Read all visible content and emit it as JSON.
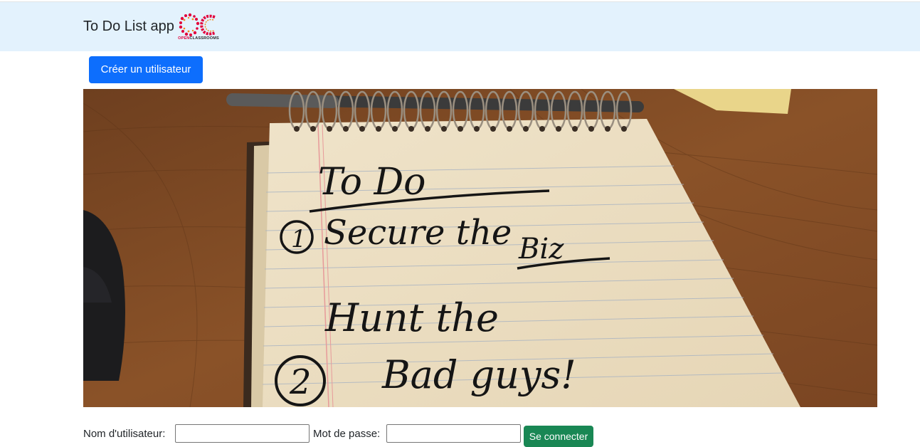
{
  "navbar": {
    "brand": "To Do List app",
    "logo_text_a": "OPEN",
    "logo_text_b": "CLASSROOMS",
    "logo_letters": "OC",
    "colors": {
      "background": "#e3f2fd",
      "logo_red": "#e2003b"
    }
  },
  "actions": {
    "create_user_label": "Créer un utilisateur",
    "accent_color": "#0d6efd"
  },
  "hero": {
    "title_line": "To Do",
    "item_1": "Secure the",
    "item_1b": "Biz",
    "item_2": "Hunt the",
    "item_2b": "Bad guys!",
    "num_1": "1",
    "num_2": "2"
  },
  "login": {
    "username_label": "Nom d'utilisateur:",
    "username_value": "",
    "password_label": "Mot de passe:",
    "password_value": "",
    "submit_label": "Se connecter",
    "submit_color": "#198754"
  }
}
